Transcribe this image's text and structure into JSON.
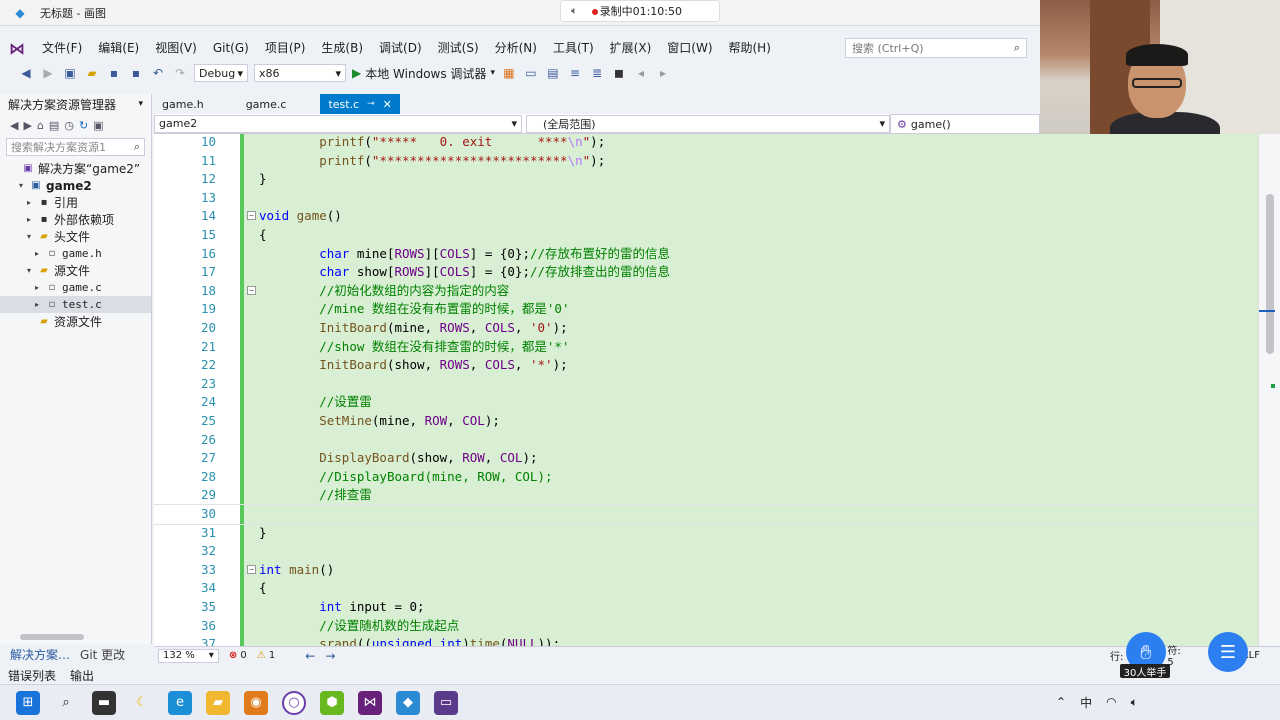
{
  "paint": {
    "title": "无标题 - 画图"
  },
  "recorder": {
    "status": "录制中01:10:50"
  },
  "menu": [
    "文件(F)",
    "编辑(E)",
    "视图(V)",
    "Git(G)",
    "项目(P)",
    "生成(B)",
    "调试(D)",
    "测试(S)",
    "分析(N)",
    "工具(T)",
    "扩展(X)",
    "窗口(W)",
    "帮助(H)"
  ],
  "search": {
    "placeholder": "搜索 (Ctrl+Q)"
  },
  "toolbar": {
    "config": "Debug",
    "platform": "x86",
    "run_label": "本地 Windows 调试器"
  },
  "solution_explorer": {
    "title": "解决方案资源管理器",
    "search_placeholder": "搜索解决方案资源1",
    "tree": [
      {
        "label": "解决方案“game2”",
        "level": 0,
        "icon": "solution-icon",
        "arrow": ""
      },
      {
        "label": "game2",
        "level": 1,
        "icon": "project-icon",
        "arrow": "▾",
        "bold": true
      },
      {
        "label": "引用",
        "level": 2,
        "icon": "references-icon",
        "arrow": "▸"
      },
      {
        "label": "外部依赖项",
        "level": 2,
        "icon": "external-deps-icon",
        "arrow": "▸"
      },
      {
        "label": "头文件",
        "level": 2,
        "icon": "folder-icon",
        "arrow": "▾"
      },
      {
        "label": "game.h",
        "level": 3,
        "icon": "header-file-icon",
        "arrow": "▸"
      },
      {
        "label": "源文件",
        "level": 2,
        "icon": "folder-icon",
        "arrow": "▾"
      },
      {
        "label": "game.c",
        "level": 3,
        "icon": "source-file-icon",
        "arrow": "▸"
      },
      {
        "label": "test.c",
        "level": 3,
        "icon": "source-file-icon",
        "arrow": "▸",
        "selected": true
      },
      {
        "label": "资源文件",
        "level": 2,
        "icon": "folder-icon",
        "arrow": ""
      }
    ],
    "bottom_tabs": [
      "解决方案…",
      "Git 更改"
    ]
  },
  "tabs": [
    {
      "label": "game.h",
      "active": false
    },
    {
      "label": "game.c",
      "active": false
    },
    {
      "label": "test.c",
      "active": true
    }
  ],
  "navbar": {
    "project": "game2",
    "scope": "(全局范围)",
    "member": "game()"
  },
  "code": [
    {
      "n": "10",
      "t": "        printf(\"*****   0. exit      ****\\n\");"
    },
    {
      "n": "11",
      "t": "        printf(\"*************************\\n\");"
    },
    {
      "n": "12",
      "t": "}"
    },
    {
      "n": "13",
      "t": ""
    },
    {
      "n": "14",
      "t": "void game()"
    },
    {
      "n": "15",
      "t": "{"
    },
    {
      "n": "16",
      "t": "        char mine[ROWS][COLS] = {0};//存放布置好的雷的信息"
    },
    {
      "n": "17",
      "t": "        char show[ROWS][COLS] = {0};//存放排查出的雷的信息"
    },
    {
      "n": "18",
      "t": "        //初始化数组的内容为指定的内容"
    },
    {
      "n": "19",
      "t": "        //mine 数组在没有布置雷的时候，都是'0'"
    },
    {
      "n": "20",
      "t": "        InitBoard(mine, ROWS, COLS, '0');"
    },
    {
      "n": "21",
      "t": "        //show 数组在没有排查雷的时候，都是'*'"
    },
    {
      "n": "22",
      "t": "        InitBoard(show, ROWS, COLS, '*');"
    },
    {
      "n": "23",
      "t": ""
    },
    {
      "n": "24",
      "t": "        //设置雷"
    },
    {
      "n": "25",
      "t": "        SetMine(mine, ROW, COL);"
    },
    {
      "n": "26",
      "t": ""
    },
    {
      "n": "27",
      "t": "        DisplayBoard(show, ROW, COL);"
    },
    {
      "n": "28",
      "t": "        //DisplayBoard(mine, ROW, COL);"
    },
    {
      "n": "29",
      "t": "        //排查雷"
    },
    {
      "n": "30",
      "t": ""
    },
    {
      "n": "31",
      "t": "}"
    },
    {
      "n": "32",
      "t": ""
    },
    {
      "n": "33",
      "t": "int main()"
    },
    {
      "n": "34",
      "t": "{"
    },
    {
      "n": "35",
      "t": "        int input = 0;"
    },
    {
      "n": "36",
      "t": "        //设置随机数的生成起点"
    },
    {
      "n": "37",
      "t": "        srand((unsigned int)time(NULL));"
    }
  ],
  "status": {
    "zoom": "132 %",
    "errors": "0",
    "warnings": "1",
    "row_label": "行:",
    "col_label": "符: 5",
    "eol": "CRLF"
  },
  "bottom_panel_tabs": [
    "错误列表",
    "输出"
  ],
  "raise_hand": {
    "label": "30人举手"
  },
  "tray": {
    "ime": "中"
  },
  "colors": {
    "accent": "#007acc",
    "changed_bar": "#57c95a",
    "code_bg": "#d8efd3"
  }
}
